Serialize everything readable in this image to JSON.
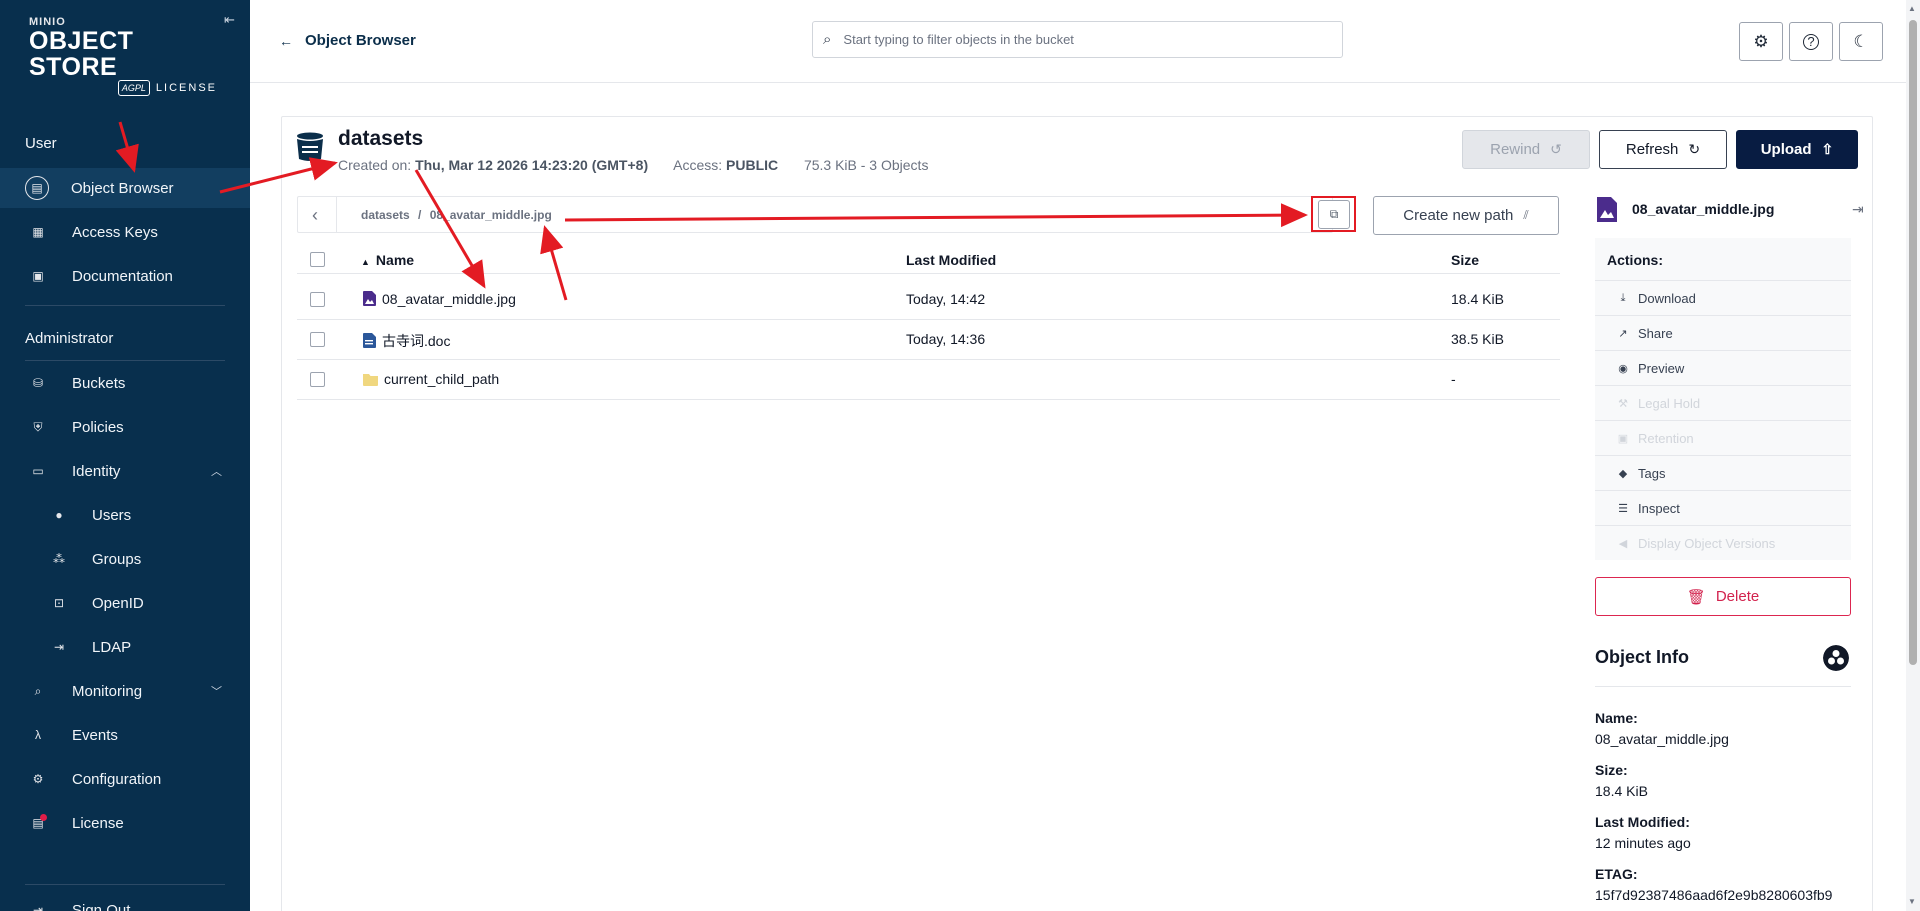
{
  "sidebar": {
    "logo": {
      "brand": "MINIO",
      "product": "OBJECT STORE",
      "license_badge": "AGPL",
      "license_text": "LICENSE"
    },
    "sections": {
      "user": "User",
      "administrator": "Administrator"
    },
    "items": {
      "object_browser": "Object Browser",
      "access_keys": "Access Keys",
      "documentation": "Documentation",
      "buckets": "Buckets",
      "policies": "Policies",
      "identity": "Identity",
      "users": "Users",
      "groups": "Groups",
      "openid": "OpenID",
      "ldap": "LDAP",
      "monitoring": "Monitoring",
      "events": "Events",
      "configuration": "Configuration",
      "license": "License",
      "sign_out": "Sign Out"
    }
  },
  "topbar": {
    "back_label": "Object Browser",
    "search_placeholder": "Start typing to filter objects in the bucket"
  },
  "bucket": {
    "name": "datasets",
    "created_label": "Created on:",
    "created_value": "Thu, Mar 12 2026 14:23:20 (GMT+8)",
    "access_label": "Access:",
    "access_value": "PUBLIC",
    "usage": "75.3 KiB - 3 Objects",
    "buttons": {
      "rewind": "Rewind",
      "refresh": "Refresh",
      "upload": "Upload"
    }
  },
  "breadcrumb": {
    "root": "datasets",
    "separator": "/",
    "current": "08_avatar_middle.jpg",
    "create_path_label": "Create new path"
  },
  "table": {
    "columns": {
      "name": "Name",
      "modified": "Last Modified",
      "size": "Size"
    },
    "rows": [
      {
        "name": "08_avatar_middle.jpg",
        "modified": "Today, 14:42",
        "size": "18.4 KiB",
        "type": "image"
      },
      {
        "name": "古寺词.doc",
        "modified": "Today, 14:36",
        "size": "38.5 KiB",
        "type": "document"
      },
      {
        "name": "current_child_path",
        "modified": "",
        "size": "-",
        "type": "folder"
      }
    ]
  },
  "details": {
    "file_name": "08_avatar_middle.jpg",
    "actions_title": "Actions:",
    "actions": {
      "download": "Download",
      "share": "Share",
      "preview": "Preview",
      "legal_hold": "Legal Hold",
      "retention": "Retention",
      "tags": "Tags",
      "inspect": "Inspect",
      "versions": "Display Object Versions"
    },
    "delete_label": "Delete",
    "info_title": "Object Info",
    "info": {
      "name_label": "Name:",
      "name_value": "08_avatar_middle.jpg",
      "size_label": "Size:",
      "size_value": "18.4 KiB",
      "modified_label": "Last Modified:",
      "modified_value": "12 minutes ago",
      "etag_label": "ETAG:",
      "etag_value": "15f7d92387486aad6f2e9b8280603fb9"
    }
  },
  "colors": {
    "sidebar_bg": "#082f4d",
    "primary": "#081c42",
    "danger": "#d2224d",
    "annotation": "#e31b23",
    "image_icon": "#4b2c8c",
    "doc_icon": "#2b579a",
    "folder_icon": "#f0d77f"
  }
}
